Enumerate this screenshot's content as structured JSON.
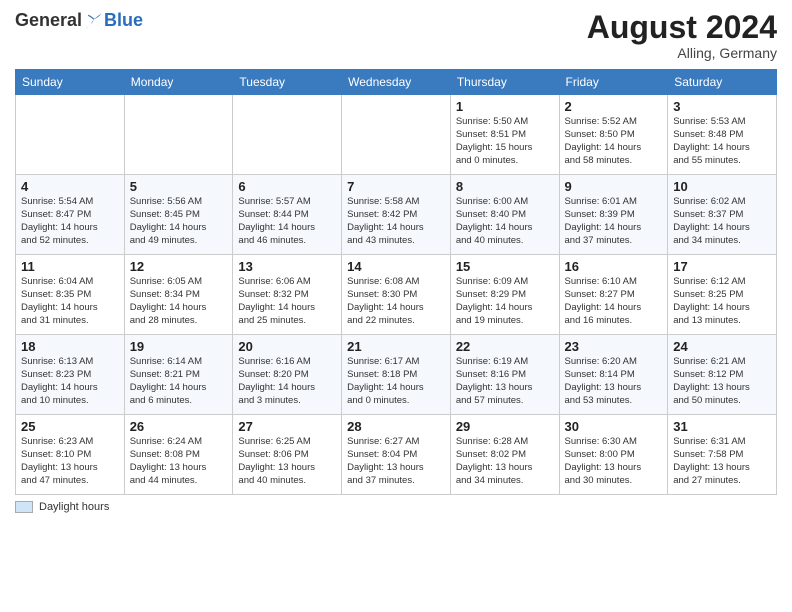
{
  "header": {
    "logo_general": "General",
    "logo_blue": "Blue",
    "month_year": "August 2024",
    "location": "Alling, Germany"
  },
  "legend": {
    "label": "Daylight hours"
  },
  "days_of_week": [
    "Sunday",
    "Monday",
    "Tuesday",
    "Wednesday",
    "Thursday",
    "Friday",
    "Saturday"
  ],
  "weeks": [
    [
      {
        "day": "",
        "info": ""
      },
      {
        "day": "",
        "info": ""
      },
      {
        "day": "",
        "info": ""
      },
      {
        "day": "",
        "info": ""
      },
      {
        "day": "1",
        "info": "Sunrise: 5:50 AM\nSunset: 8:51 PM\nDaylight: 15 hours\nand 0 minutes."
      },
      {
        "day": "2",
        "info": "Sunrise: 5:52 AM\nSunset: 8:50 PM\nDaylight: 14 hours\nand 58 minutes."
      },
      {
        "day": "3",
        "info": "Sunrise: 5:53 AM\nSunset: 8:48 PM\nDaylight: 14 hours\nand 55 minutes."
      }
    ],
    [
      {
        "day": "4",
        "info": "Sunrise: 5:54 AM\nSunset: 8:47 PM\nDaylight: 14 hours\nand 52 minutes."
      },
      {
        "day": "5",
        "info": "Sunrise: 5:56 AM\nSunset: 8:45 PM\nDaylight: 14 hours\nand 49 minutes."
      },
      {
        "day": "6",
        "info": "Sunrise: 5:57 AM\nSunset: 8:44 PM\nDaylight: 14 hours\nand 46 minutes."
      },
      {
        "day": "7",
        "info": "Sunrise: 5:58 AM\nSunset: 8:42 PM\nDaylight: 14 hours\nand 43 minutes."
      },
      {
        "day": "8",
        "info": "Sunrise: 6:00 AM\nSunset: 8:40 PM\nDaylight: 14 hours\nand 40 minutes."
      },
      {
        "day": "9",
        "info": "Sunrise: 6:01 AM\nSunset: 8:39 PM\nDaylight: 14 hours\nand 37 minutes."
      },
      {
        "day": "10",
        "info": "Sunrise: 6:02 AM\nSunset: 8:37 PM\nDaylight: 14 hours\nand 34 minutes."
      }
    ],
    [
      {
        "day": "11",
        "info": "Sunrise: 6:04 AM\nSunset: 8:35 PM\nDaylight: 14 hours\nand 31 minutes."
      },
      {
        "day": "12",
        "info": "Sunrise: 6:05 AM\nSunset: 8:34 PM\nDaylight: 14 hours\nand 28 minutes."
      },
      {
        "day": "13",
        "info": "Sunrise: 6:06 AM\nSunset: 8:32 PM\nDaylight: 14 hours\nand 25 minutes."
      },
      {
        "day": "14",
        "info": "Sunrise: 6:08 AM\nSunset: 8:30 PM\nDaylight: 14 hours\nand 22 minutes."
      },
      {
        "day": "15",
        "info": "Sunrise: 6:09 AM\nSunset: 8:29 PM\nDaylight: 14 hours\nand 19 minutes."
      },
      {
        "day": "16",
        "info": "Sunrise: 6:10 AM\nSunset: 8:27 PM\nDaylight: 14 hours\nand 16 minutes."
      },
      {
        "day": "17",
        "info": "Sunrise: 6:12 AM\nSunset: 8:25 PM\nDaylight: 14 hours\nand 13 minutes."
      }
    ],
    [
      {
        "day": "18",
        "info": "Sunrise: 6:13 AM\nSunset: 8:23 PM\nDaylight: 14 hours\nand 10 minutes."
      },
      {
        "day": "19",
        "info": "Sunrise: 6:14 AM\nSunset: 8:21 PM\nDaylight: 14 hours\nand 6 minutes."
      },
      {
        "day": "20",
        "info": "Sunrise: 6:16 AM\nSunset: 8:20 PM\nDaylight: 14 hours\nand 3 minutes."
      },
      {
        "day": "21",
        "info": "Sunrise: 6:17 AM\nSunset: 8:18 PM\nDaylight: 14 hours\nand 0 minutes."
      },
      {
        "day": "22",
        "info": "Sunrise: 6:19 AM\nSunset: 8:16 PM\nDaylight: 13 hours\nand 57 minutes."
      },
      {
        "day": "23",
        "info": "Sunrise: 6:20 AM\nSunset: 8:14 PM\nDaylight: 13 hours\nand 53 minutes."
      },
      {
        "day": "24",
        "info": "Sunrise: 6:21 AM\nSunset: 8:12 PM\nDaylight: 13 hours\nand 50 minutes."
      }
    ],
    [
      {
        "day": "25",
        "info": "Sunrise: 6:23 AM\nSunset: 8:10 PM\nDaylight: 13 hours\nand 47 minutes."
      },
      {
        "day": "26",
        "info": "Sunrise: 6:24 AM\nSunset: 8:08 PM\nDaylight: 13 hours\nand 44 minutes."
      },
      {
        "day": "27",
        "info": "Sunrise: 6:25 AM\nSunset: 8:06 PM\nDaylight: 13 hours\nand 40 minutes."
      },
      {
        "day": "28",
        "info": "Sunrise: 6:27 AM\nSunset: 8:04 PM\nDaylight: 13 hours\nand 37 minutes."
      },
      {
        "day": "29",
        "info": "Sunrise: 6:28 AM\nSunset: 8:02 PM\nDaylight: 13 hours\nand 34 minutes."
      },
      {
        "day": "30",
        "info": "Sunrise: 6:30 AM\nSunset: 8:00 PM\nDaylight: 13 hours\nand 30 minutes."
      },
      {
        "day": "31",
        "info": "Sunrise: 6:31 AM\nSunset: 7:58 PM\nDaylight: 13 hours\nand 27 minutes."
      }
    ]
  ]
}
